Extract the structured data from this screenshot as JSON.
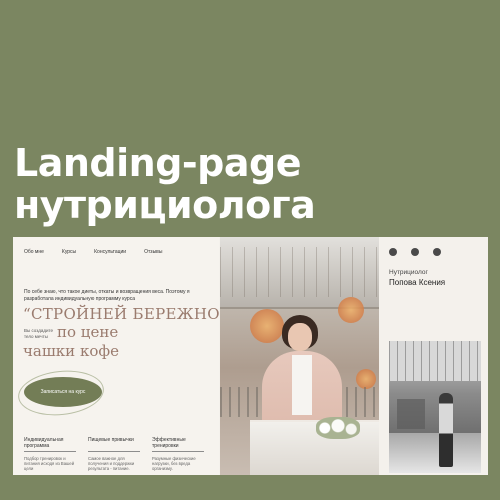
{
  "headline": {
    "line1": "Landing-page",
    "line2": "нутрициолога"
  },
  "nav": {
    "items": [
      "Обо мне",
      "Курсы",
      "Консультации",
      "Отзывы"
    ]
  },
  "hero": {
    "intro": "По себе знаю, что такое диеты, откаты и возвращения веса. Поэтому я разработала индивидуальную программу курса",
    "title_line1": "“СТРОЙНЕЙ БЕРЕЖНО”",
    "note": "Вы создадите тело мечты",
    "title_line2": "по цене",
    "title_line3": "чашки кофе",
    "cta_label": "Записаться на курс"
  },
  "features": [
    {
      "title": "Индивидуальная программа",
      "desc": "Подбор тренировок и питания исходя из Вашей цели"
    },
    {
      "title": "Пищевые привычки",
      "desc": "Самое важное для получения и поддержки результата - питание."
    },
    {
      "title": "Эффективные тренировки",
      "desc": "Разумные физические нагрузки, без вреда организму."
    }
  ],
  "profile": {
    "role": "Нутрициолог",
    "name": "Попова Ксения",
    "social_icons": [
      "vk-icon",
      "whatsapp-icon",
      "telegram-icon"
    ]
  },
  "colors": {
    "background": "#7b8661",
    "accent_button": "#737d56",
    "title_text": "#9a7b6e",
    "panel": "#f6f3ee"
  }
}
